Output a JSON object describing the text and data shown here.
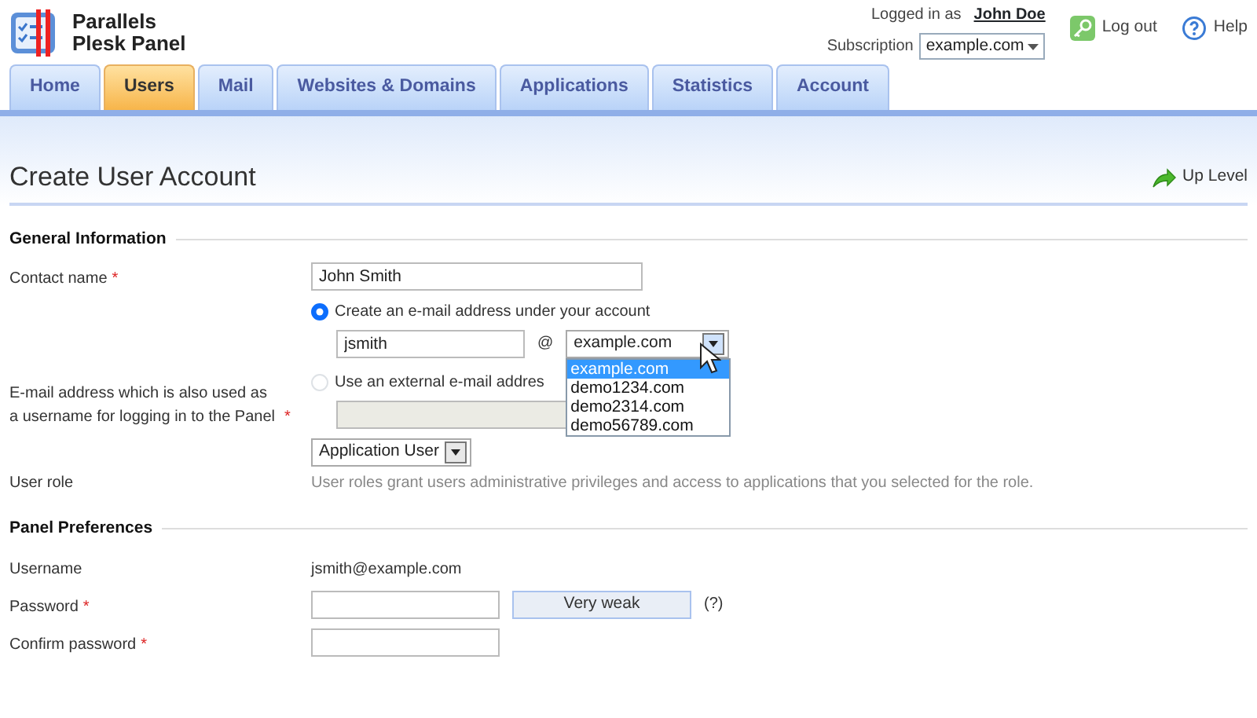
{
  "header": {
    "product_lines": [
      "Parallels",
      "Plesk Panel"
    ],
    "logged_in_label": "Logged in as",
    "user_name": "John Doe",
    "subscription_label": "Subscription",
    "subscription_value": "example.com",
    "logout": "Log out",
    "help": "Help"
  },
  "tabs": [
    {
      "label": "Home",
      "selected": false
    },
    {
      "label": "Users",
      "selected": true
    },
    {
      "label": "Mail",
      "selected": false
    },
    {
      "label": "Websites & Domains",
      "selected": false
    },
    {
      "label": "Applications",
      "selected": false
    },
    {
      "label": "Statistics",
      "selected": false
    },
    {
      "label": "Account",
      "selected": false
    }
  ],
  "page_title": "Create User Account",
  "up_level": "Up Level",
  "sections": [
    {
      "title": "General Information",
      "fields": [
        {
          "kind": "text",
          "label": "Contact name",
          "required_mark": "*",
          "value": "John Smith"
        },
        {
          "kind": "email",
          "label": "E-mail address which is also used as a username for logging in to the Panel",
          "required_mark": "*",
          "options": [
            {
              "kind": "create",
              "label": "Create an e-mail address under your account",
              "selected": true,
              "local_part": "jsmith",
              "at": "@",
              "domain": "example.com",
              "expanded": true,
              "items": [
                {
                  "label": "example.com",
                  "selected": true
                },
                {
                  "label": "demo1234.com",
                  "selected": false
                },
                {
                  "label": "demo2314.com",
                  "selected": false
                },
                {
                  "label": "demo56789.com",
                  "selected": false
                }
              ]
            },
            {
              "kind": "external",
              "label": "Use an external e-mail addres",
              "selected": false,
              "disabled": true
            }
          ]
        },
        {
          "kind": "select",
          "label": "User role",
          "value": "Application User",
          "hint": "User roles grant users administrative privileges and access to applications that you selected for the role."
        }
      ]
    },
    {
      "title": "Panel Preferences",
      "fields": [
        {
          "kind": "static",
          "label": "Username",
          "value": "jsmith@example.com"
        },
        {
          "kind": "password",
          "label": "Password",
          "required_mark": "*",
          "strength": "Very weak",
          "help": "(?)"
        },
        {
          "kind": "password",
          "label": "Confirm password",
          "required_mark": "*"
        }
      ]
    }
  ]
}
